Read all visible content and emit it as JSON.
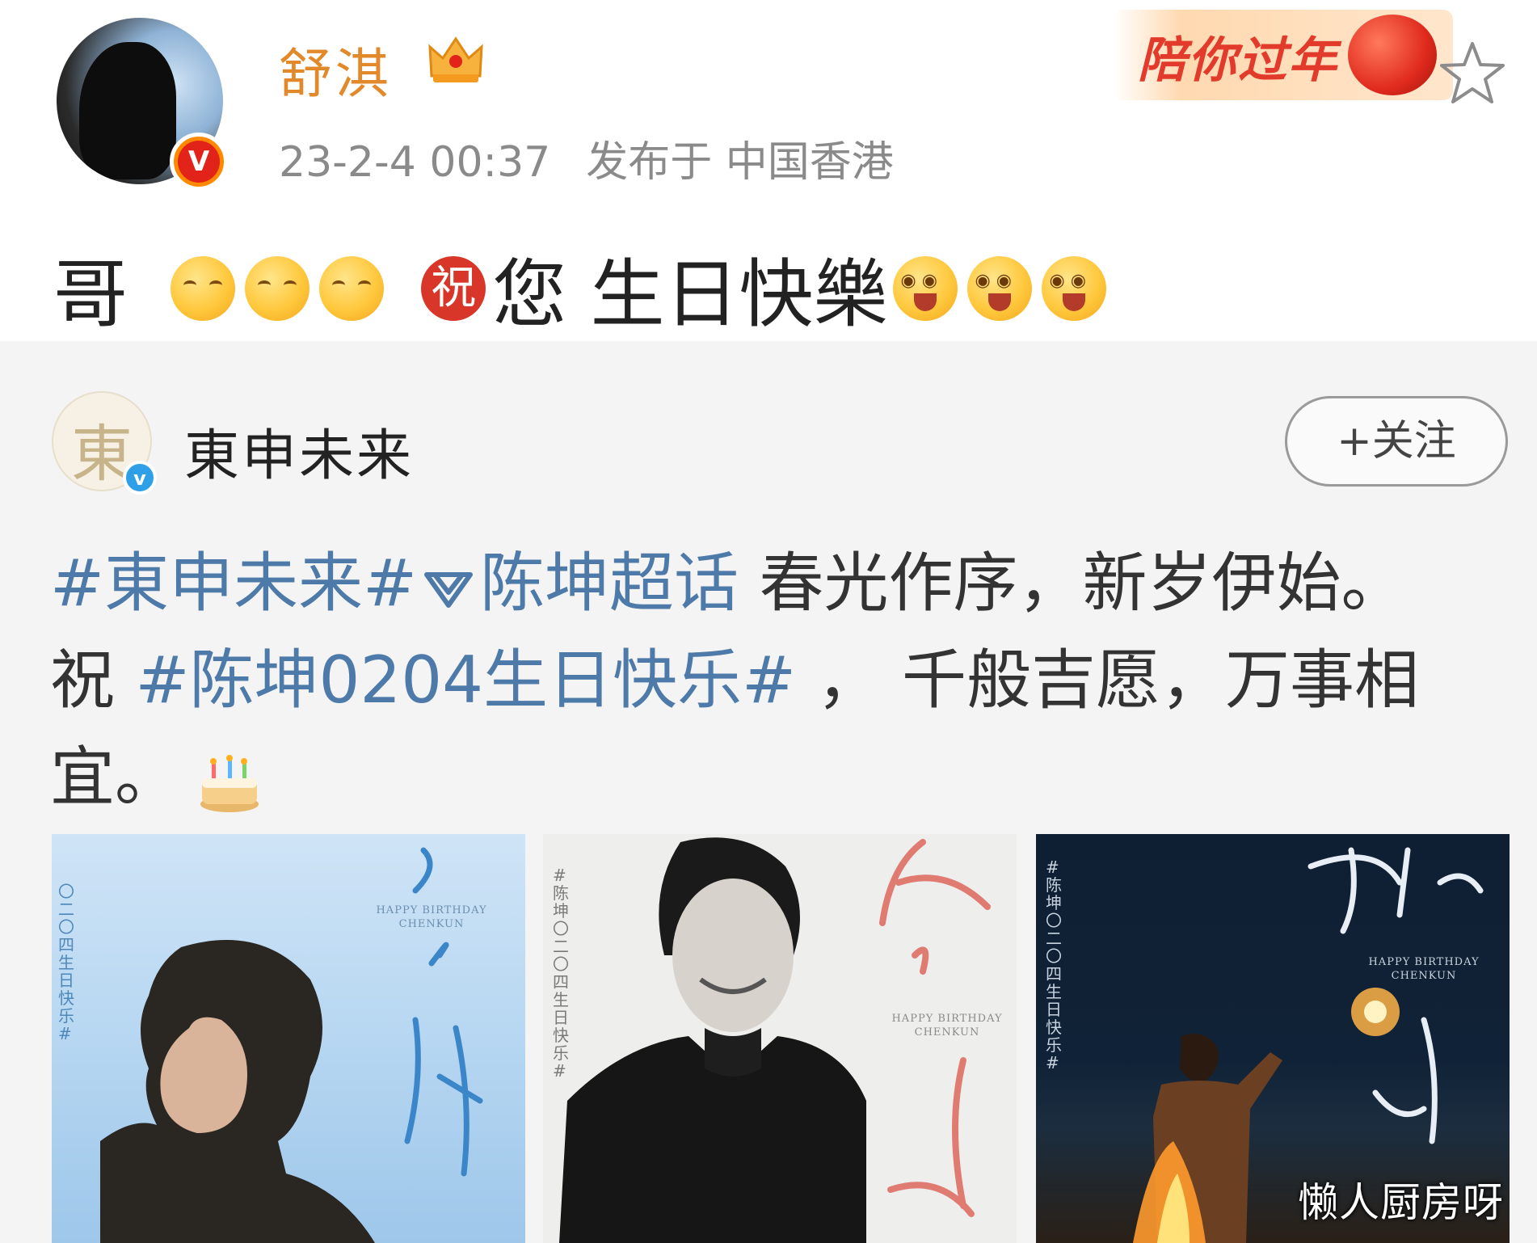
{
  "post": {
    "user_name": "舒淇",
    "timestamp": "23-2-4 00:37",
    "location": "发布于 中国香港",
    "promo_badge": "陪你过年",
    "text": {
      "prefix": "哥",
      "zhu": "祝",
      "message": "您 生日快樂"
    }
  },
  "repost": {
    "account_name": "東申未来",
    "follow_label": "+关注",
    "text": {
      "tag1": "#東申未来#",
      "tag2": "陈坤超话",
      "line1_rest": " 春光作序，新岁伊始。",
      "line2_prefix": "祝 ",
      "tag3": "#陈坤0204生日快乐#",
      "line2_rest": " ， 千般吉愿，万事相",
      "line3": "宜。"
    },
    "photos": [
      {
        "caption": "HAPPY BIRTHDAY\nCHENKUN",
        "vertical_text": "〇二〇四生日快乐#"
      },
      {
        "caption": "HAPPY BIRTHDAY\nCHENKUN",
        "vertical_text": "#陈坤〇二〇四生日快乐#"
      },
      {
        "caption": "HAPPY BIRTHDAY\nCHENKUN",
        "vertical_text": "#陈坤〇二〇四生日快乐#"
      }
    ]
  },
  "watermark": "懒人厨房呀",
  "colors": {
    "user_name": "#e28a2b",
    "hashtag": "#4d7aa8",
    "meta": "#8a8a8a",
    "repost_bg": "#f4f4f4"
  },
  "icons": [
    "crown-icon",
    "verified-badge-icon",
    "lantern-icon",
    "star-icon",
    "shy-face-emoji",
    "zhu-icon",
    "happy-face-emoji",
    "super-topic-icon",
    "cake-emoji"
  ]
}
